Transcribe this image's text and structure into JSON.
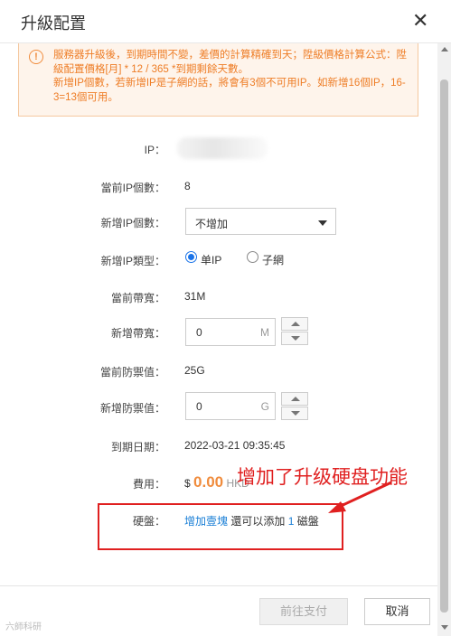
{
  "dialog": {
    "title": "升級配置"
  },
  "alert": {
    "line1": "服務器升級後，到期時間不變，差價的計算精確到天；陞級價格計算公式：陞級配置價格[月] * 12 / 365 *到期剩餘天數。",
    "line2": "新增IP個數，若新增IP是子網的話，將會有3個不可用IP。如新增16個IP，16-3=13個可用。"
  },
  "form": {
    "ip_label": "IP：",
    "current_ip_count_label": "當前IP個數：",
    "current_ip_count": "8",
    "add_ip_count_label": "新增IP個數：",
    "add_ip_count_selected": "不增加",
    "ip_type_label": "新增IP類型：",
    "ip_type_options": [
      "单IP",
      "子網"
    ],
    "current_bandwidth_label": "當前帶寬：",
    "current_bandwidth": "31M",
    "add_bandwidth_label": "新增帶寬：",
    "add_bandwidth_value": "0",
    "add_bandwidth_unit": "M",
    "current_defense_label": "當前防禦值：",
    "current_defense": "25G",
    "add_defense_label": "新增防禦值：",
    "add_defense_value": "0",
    "add_defense_unit": "G",
    "expiry_label": "到期日期：",
    "expiry": "2022-03-21 09:35:45",
    "fee_label": "費用：",
    "fee_symbol": "$",
    "fee_amount": "0.00",
    "fee_currency": "HKD",
    "disk_label": "硬盤：",
    "disk_add_link": "增加壹塊",
    "disk_remaining_prefix": "還可以添加",
    "disk_remaining_count": "1",
    "disk_remaining_suffix": "磁盤"
  },
  "annotation": {
    "text": "增加了升级硬盘功能",
    "color": "#e02020"
  },
  "footer": {
    "pay_label": "前往支付",
    "cancel_label": "取消"
  },
  "watermark": "六師科研",
  "colors": {
    "accent": "#1a7fd6",
    "warning": "#ee7d26",
    "price": "#f08c3d"
  }
}
